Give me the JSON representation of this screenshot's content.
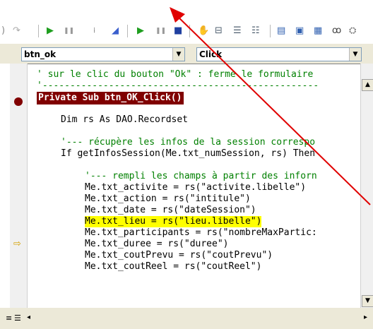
{
  "toolbar": {
    "icons": [
      "undo-icon",
      "redo-icon",
      "run-icon",
      "pause-icon",
      "grip-icon",
      "design-mode-icon",
      "run2-icon",
      "pause2-icon",
      "reset-icon",
      "hand-icon",
      "project-icon",
      "properties-icon",
      "object-browser-icon",
      "toolbox-icon",
      "form-icon",
      "watch-icon",
      "binoculars-icon",
      "tools-icon"
    ]
  },
  "combos": {
    "object": "btn_ok",
    "procedure": "Click"
  },
  "code_lines": [
    {
      "text": "' sur le clic du bouton \"Ok\" : ferme le formulaire",
      "kind": "comment",
      "indent": 0
    },
    {
      "text": "'--------------------------------------------------",
      "kind": "comment",
      "indent": 0
    },
    {
      "text": "Private Sub btn_OK_Click()",
      "kind": "breakpoint",
      "indent": 0
    },
    {
      "text": "",
      "kind": "plain",
      "indent": 0
    },
    {
      "text": "Dim rs As DAO.Recordset",
      "kind": "plain",
      "indent": 4
    },
    {
      "text": "",
      "kind": "plain",
      "indent": 0
    },
    {
      "text": "'--- récupère les infos de la session correspo",
      "kind": "comment",
      "indent": 4
    },
    {
      "text": "If getInfosSession(Me.txt_numSession, rs) Then",
      "kind": "plain",
      "indent": 4
    },
    {
      "text": "",
      "kind": "plain",
      "indent": 0
    },
    {
      "text": "'--- rempli les champs à partir des inforn",
      "kind": "comment",
      "indent": 8
    },
    {
      "text": "Me.txt_activite = rs(\"activite.libelle\")",
      "kind": "plain",
      "indent": 8
    },
    {
      "text": "Me.txt_action = rs(\"intitule\")",
      "kind": "plain",
      "indent": 8
    },
    {
      "text": "Me.txt_date = rs(\"dateSession\")",
      "kind": "plain",
      "indent": 8
    },
    {
      "text": "Me.txt_lieu = rs(\"lieu.libelle\")",
      "kind": "current",
      "indent": 8
    },
    {
      "text": "Me.txt_participants = rs(\"nombreMaxPartic:",
      "kind": "plain",
      "indent": 8
    },
    {
      "text": "Me.txt_duree = rs(\"duree\")",
      "kind": "plain",
      "indent": 8
    },
    {
      "text": "Me.txt_coutPrevu = rs(\"coutPrevu\")",
      "kind": "plain",
      "indent": 8
    },
    {
      "text": "Me.txt_coutReel = rs(\"coutReel\")",
      "kind": "plain",
      "indent": 8
    }
  ],
  "colors": {
    "breakpoint": "#800000",
    "current_line": "#ffff00",
    "comment": "#008000",
    "annotation_arrow": "#e00000"
  }
}
